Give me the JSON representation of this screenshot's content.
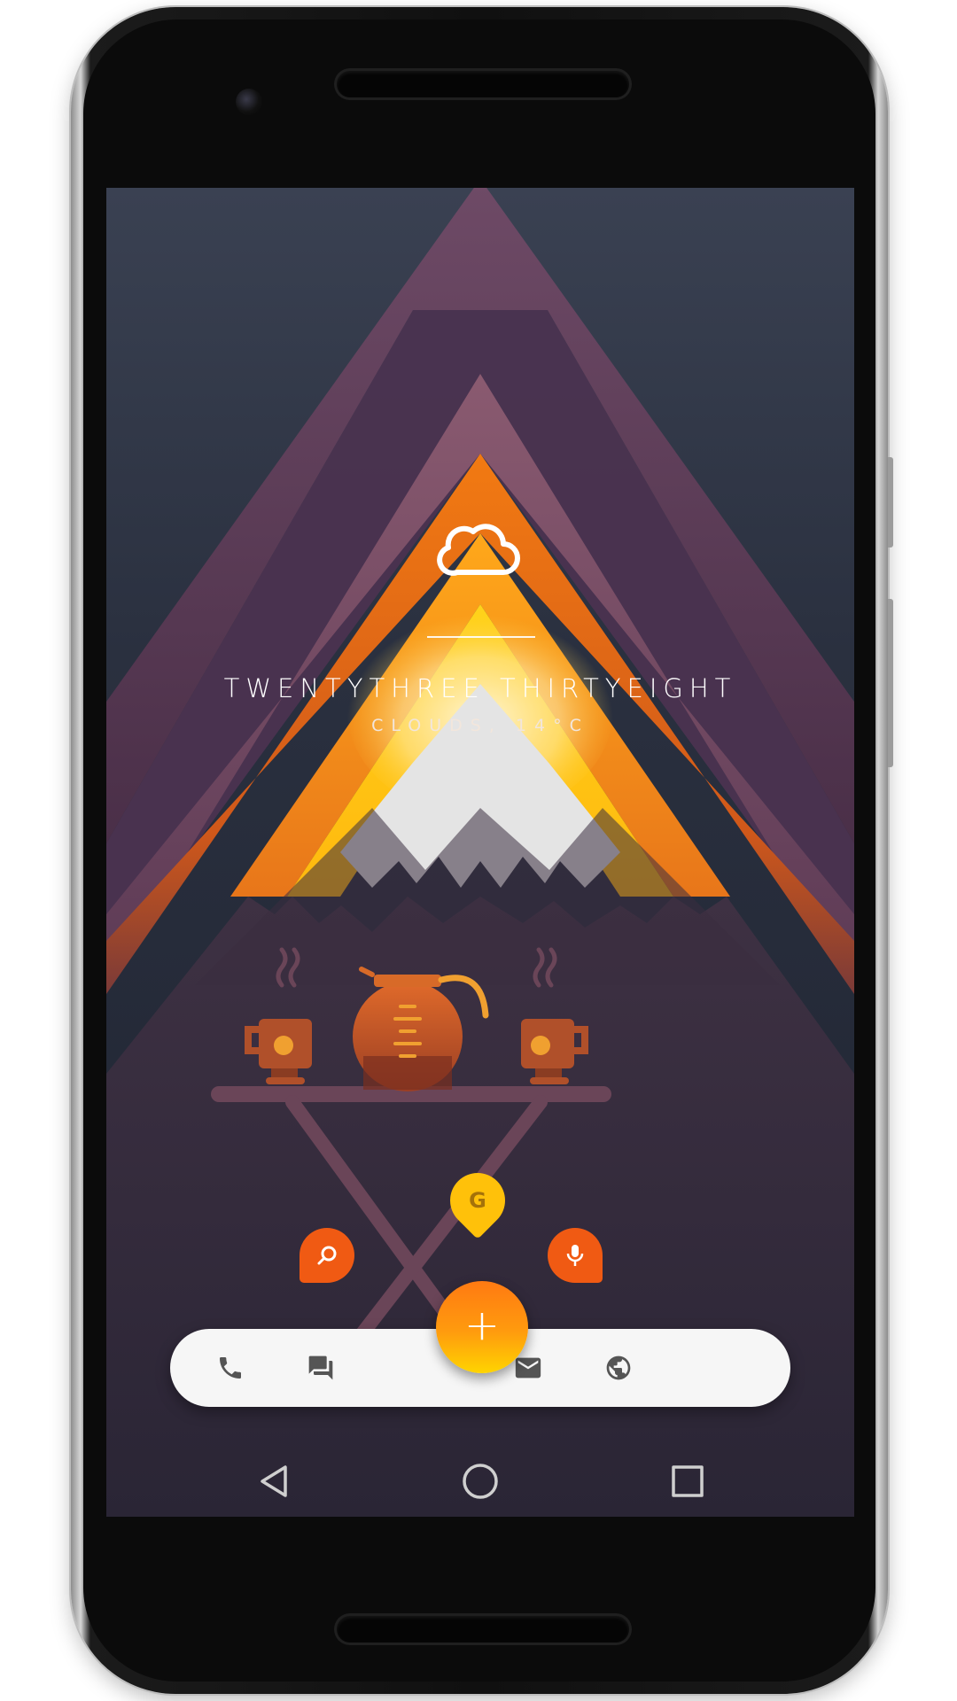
{
  "widget": {
    "weather_icon": "cloud-icon",
    "clock_text": "TWENTYTHREE THIRTYEIGHT",
    "weather_text": "CLOUDS, 14°C"
  },
  "quick_actions": [
    {
      "name": "search",
      "icon": "search-icon"
    },
    {
      "name": "google",
      "label": "G"
    },
    {
      "name": "voice",
      "icon": "mic-icon"
    }
  ],
  "dock": {
    "items": [
      {
        "name": "phone",
        "icon": "phone-icon"
      },
      {
        "name": "messages",
        "icon": "chat-icon"
      },
      {
        "name": "email",
        "icon": "mail-icon"
      },
      {
        "name": "browser",
        "icon": "globe-icon"
      }
    ],
    "fab_label": "+"
  },
  "navigation": {
    "buttons": [
      "back-icon",
      "home-icon",
      "recents-icon"
    ]
  },
  "colors": {
    "accent_orange": "#f05a13",
    "accent_yellow": "#ffc10a",
    "background_top": "#3a4152",
    "background_bottom": "#1e2330"
  }
}
